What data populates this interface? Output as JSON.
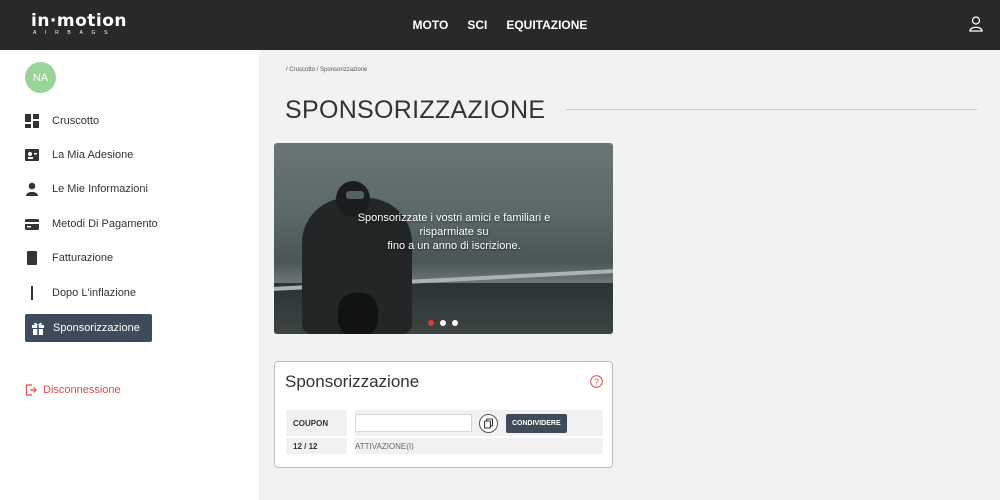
{
  "header": {
    "logo_main": "in·motion",
    "logo_sub": "AIRBAGS",
    "nav": [
      "MOTO",
      "SCI",
      "EQUITAZIONE"
    ]
  },
  "sidebar": {
    "avatar_initials": "NA",
    "items": [
      {
        "label": "Cruscotto",
        "icon": "dashboard-icon"
      },
      {
        "label": "La Mia Adesione",
        "icon": "id-card-icon"
      },
      {
        "label": "Le Mie Informazioni",
        "icon": "user-icon"
      },
      {
        "label": "Metodi Di Pagamento",
        "icon": "credit-card-icon"
      },
      {
        "label": "Fatturazione",
        "icon": "invoice-icon"
      },
      {
        "label": "Dopo L'inflazione",
        "icon": "inflation-icon"
      },
      {
        "label": "Sponsorizzazione",
        "icon": "gift-icon",
        "active": true
      }
    ],
    "logout_label": "Disconnessione"
  },
  "main": {
    "breadcrumb": "/ Cruscotto / Sponsorizzazione",
    "title": "SPONSORIZZAZIONE",
    "banner": {
      "line1": "Sponsorizzate i vostri amici e familiari e",
      "line2": "risparmiate su",
      "line3": "fino a un anno di iscrizione.",
      "slides": 3,
      "active_slide": 1
    },
    "card": {
      "title": "Sponsorizzazione",
      "coupon_label": "COUPON",
      "coupon_value": "",
      "share_label": "CONDIVIDERE",
      "count_label": "12 / 12",
      "activation_label": "ATTIVAZIONE(I)"
    }
  },
  "colors": {
    "topbar": "#292929",
    "active_item": "#3e4c59",
    "logout": "#e04b4b",
    "avatar": "#9bd49a",
    "dot_active": "#e03a3a"
  }
}
